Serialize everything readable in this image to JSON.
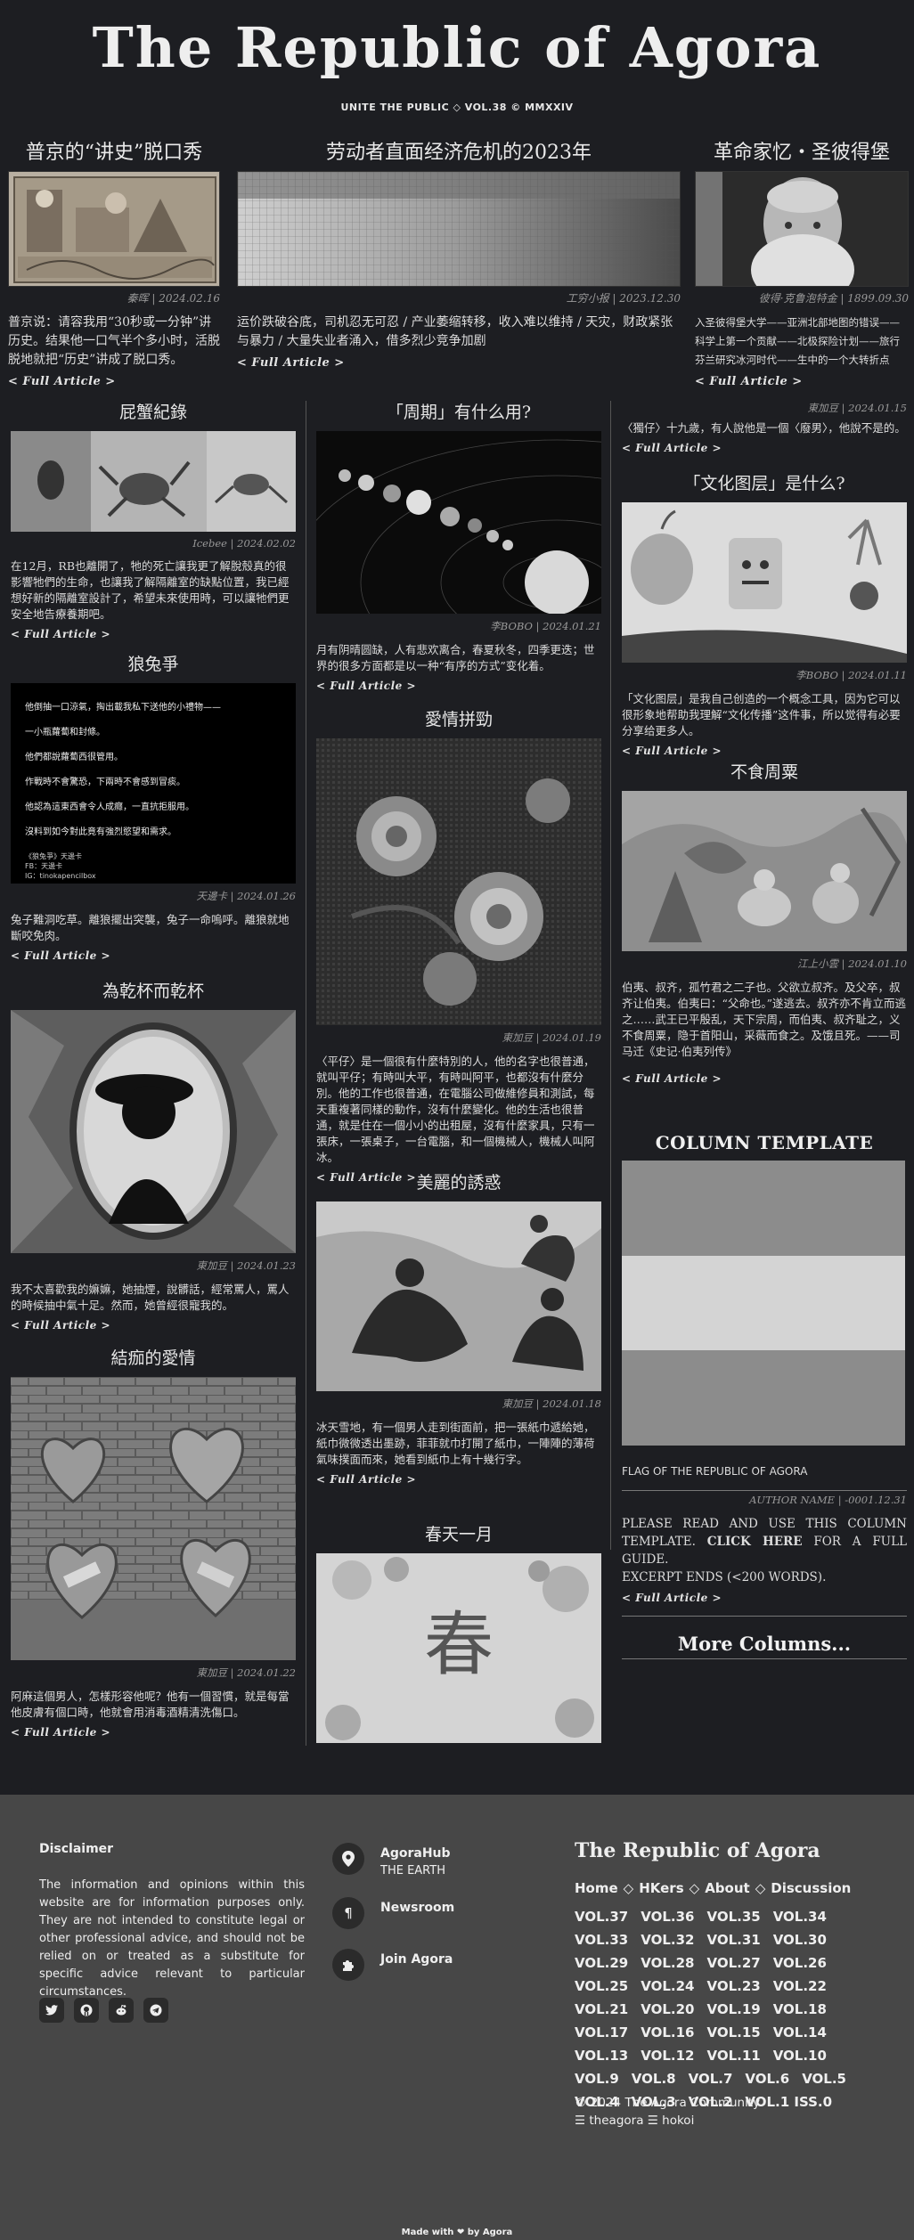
{
  "masthead": {
    "title": "The Republic of Agora",
    "issue_line": "UNITE THE PUBLIC ◇ VOL.38 © MMXXIV"
  },
  "features": [
    {
      "title": "普京的“讲史”脱口秀",
      "meta": "秦晖 | 2024.02.16",
      "excerpt": "普京说：请容我用“30秒或一分钟”讲历史。结果他一口气半个多小时，活脱脱地就把“历史”讲成了脱口秀。",
      "more": "< Full Article >"
    },
    {
      "title": "劳动者直面经济危机的2023年",
      "meta": "工穷小报 | 2023.12.30",
      "excerpt": "运价跌破谷底，司机忍无可忍 / 产业萎缩转移，收入难以维持 / 天灾，财政紧张与暴力 / 大量失业者涌入，借多烈少竞争加剧",
      "more": "< Full Article >"
    },
    {
      "title": "革命家忆・圣彼得堡",
      "meta": "彼得·克鲁泡特金 | 1899.09.30",
      "excerpt": "入圣彼得堡大学——亚洲北部地图的错误——科学上第一个贡献——北极探险计划——旅行芬兰研究冰河时代——生中的一个大转折点",
      "more": "< Full Article >"
    }
  ],
  "left_column": [
    {
      "title": "屁蟹紀錄",
      "meta": "Icebee | 2024.02.02",
      "excerpt": "在12月，RB也離開了，牠的死亡讓我更了解脫殼真的很影響牠們的生命，也讓我了解隔離室的缺點位置，我已經想好新的隔離室設計了，希望未來使用時，可以讓牠們更安全地告療養期吧。",
      "more": "< Full Article >"
    },
    {
      "title": "狼兔爭",
      "meta": "天邊卡 | 2024.01.26",
      "poem": [
        "他倒抽一口涼氣，掏出載我私下送他的小禮物——",
        "一小瓶蘿蔔和封條。",
        "他們都說蘿蔔西很管用。",
        "作戰時不會驚恐，下兩時不會感到冒痰。",
        "他認為這東西會令人成癮，一直抗拒服用。",
        "沒料到如今對此竟有強烈慾望和需求。"
      ],
      "poem_credit": [
        "《狼兔爭》天邊卡",
        "FB：天邊卡",
        "IG：tinokapencilbox"
      ],
      "excerpt": "兔子難洞吃草。離狼擺出突襲，兔子一命嗚呼。離狼就地斷咬免肉。",
      "more": "< Full Article >"
    },
    {
      "title": "為乾杯而乾杯",
      "meta": "東加豆 | 2024.01.23",
      "excerpt": "我不太喜歡我的嫲嫲，她抽煙，說髒話，經常罵人，罵人的時候抽中氣十足。然而，她曾經很寵我的。",
      "more": "< Full Article >"
    },
    {
      "title": "結痂的愛情",
      "meta": "東加豆 | 2024.01.22",
      "excerpt": "阿麻這個男人，怎樣形容他呢？他有一個習慣，就是每當他皮膚有個口時，他就會用消毒酒精清洗傷口。",
      "more": "< Full Article >"
    }
  ],
  "middle_column": [
    {
      "title": "「周期」有什么用?",
      "meta": "李BOBO | 2024.01.21",
      "excerpt": "月有阴晴圆缺，人有悲欢离合，春夏秋冬，四季更迭；世界的很多方面都是以一种“有序的方式”变化着。",
      "more": "< Full Article >"
    },
    {
      "title": "愛情拼勁",
      "meta": "東加豆 | 2024.01.19",
      "excerpt": "〈平仔〉是一個很有什麼特別的人，他的名字也很普通，就叫平仔；有時叫大平，有時叫阿平，也都沒有什麼分別。他的工作也很普通，在電腦公司做維修員和測試，每天重複著同樣的動作，沒有什麼變化。他的生活也很普通，就是住在一個小小的出租屋，沒有什麼家具，只有一張床，一張桌子，一台電腦，和一個機械人，機械人叫阿冰。",
      "more": "< Full Article >"
    },
    {
      "title": "美麗的誘惑",
      "meta": "東加豆 | 2024.01.18",
      "excerpt": "冰天雪地，有一個男人走到街面前，把一張紙巾遞給她，紙巾微微透出墨跡，菲菲就巾打開了紙巾，一陣陣的薄荷氣味撲面而來，她看到紙巾上有十幾行字。",
      "more": "< Full Article >"
    },
    {
      "title": "春天一月",
      "image_char": "春"
    }
  ],
  "right_column": {
    "first": {
      "meta": "東加豆 | 2024.01.15",
      "excerpt": "〈獨仔〉十九歲，有人說他是一個〈廢男〉，他說不是的。",
      "more": "< Full Article >"
    },
    "cards": [
      {
        "title": "「文化图层」是什么?",
        "meta": "李BOBO | 2024.01.11",
        "excerpt": "「文化图层」是我自己创造的一个概念工具，因为它可以很形象地帮助我理解“文化传播”这件事，所以觉得有必要分享给更多人。",
        "more": "< Full Article >"
      },
      {
        "title": "不食周粟",
        "meta": "江上小雲 | 2024.01.10",
        "excerpt": "伯夷、叔齐，孤竹君之二子也。父欲立叔齐。及父卒，叔齐让伯夷。伯夷曰：“父命也。”遂逃去。叔齐亦不肯立而逃之……武王已平殷乱，天下宗周，而伯夷、叔齐耻之，义不食周粟，隐于首阳山，采薇而食之。及饿且死。——司马迁《史记·伯夷列传》",
        "more": "< Full Article >"
      }
    ],
    "template": {
      "title": "COLUMN TEMPLATE",
      "caption": "FLAG OF THE REPUBLIC OF AGORA",
      "meta": "AUTHOR NAME | -0001.12.31",
      "text_before": "PLEASE READ AND USE THIS COLUMN TEMPLATE. ",
      "text_link": "CLICK HERE",
      "text_after": " FOR A FULL GUIDE.",
      "excerpt_note": "EXCERPT ENDS (<200 WORDS).",
      "more": "< Full Article >",
      "flag_colors": [
        "#8c8c8c",
        "#d4d4d4",
        "#8c8c8c"
      ]
    },
    "more_columns": "More Columns..."
  },
  "footer": {
    "disclaimer_title": "Disclaimer",
    "disclaimer_text": "The information and opinions within this website are for information purposes only. They are not intended to constitute legal or other professional advice, and should not be relied on or treated as a substitute for specific advice relevant to particular circumstances.",
    "social_icons": [
      "twitter-icon",
      "github-icon",
      "reddit-icon",
      "telegram-icon"
    ],
    "links": [
      {
        "label": "AgoraHub",
        "sub": "THE EARTH",
        "icon": "map-pin-icon"
      },
      {
        "label": "Newsroom",
        "sub": "",
        "icon": "pilcrow-icon"
      },
      {
        "label": "Join Agora",
        "sub": "",
        "icon": "puzzle-icon"
      }
    ],
    "brand": "The Republic of Agora",
    "nav": [
      "Home",
      "HKers",
      "About",
      "Discussion"
    ],
    "volumes": [
      "VOL.37",
      "VOL.36",
      "VOL.35",
      "VOL.34",
      "VOL.33",
      "VOL.32",
      "VOL.31",
      "VOL.30",
      "VOL.29",
      "VOL.28",
      "VOL.27",
      "VOL.26",
      "VOL.25",
      "VOL.24",
      "VOL.23",
      "VOL.22",
      "VOL.21",
      "VOL.20",
      "VOL.19",
      "VOL.18",
      "VOL.17",
      "VOL.16",
      "VOL.15",
      "VOL.14",
      "VOL.13",
      "VOL.12",
      "VOL.11",
      "VOL.10",
      "VOL.9",
      "VOL.8",
      "VOL.7",
      "VOL.6",
      "VOL.5",
      "VOL.4",
      "VOL.3",
      "VOL.2",
      "VOL.1 ISS.0"
    ],
    "copyright": "© 2024 The Agora Community",
    "authors": "☰ theagora ☰ hokoi",
    "made_with": "Made with ❤ by Agora"
  }
}
